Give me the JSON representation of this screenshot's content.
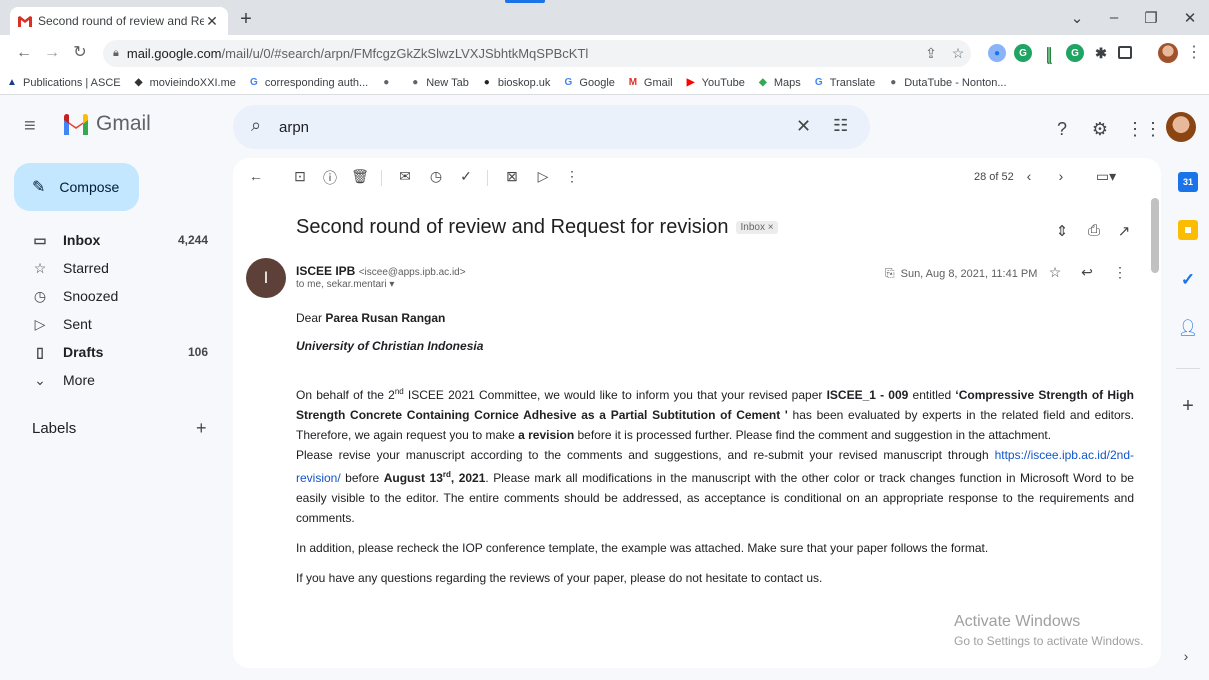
{
  "browser": {
    "tab_title": "Second round of review and Req",
    "tab_close": "✕",
    "new_tab": "+",
    "url_host": "mail.google.com",
    "url_path": "/mail/u/0/#search/arpn/FMfcgzGkZkSlwzLVXJSbhtkMqSPBcKTl"
  },
  "bookmarks": [
    {
      "label": "Publications | ASCE",
      "icon": "asce-icon",
      "glyph": "▲",
      "color": "#1a3c8c"
    },
    {
      "label": "movieindoXXI.me",
      "icon": "bird-icon",
      "glyph": "◆",
      "color": "#333"
    },
    {
      "label": "corresponding auth...",
      "icon": "google-icon",
      "glyph": "G",
      "color": "#4285f4"
    },
    {
      "label": "",
      "icon": "globe-icon",
      "glyph": "●",
      "color": "#5f6368"
    },
    {
      "label": "New Tab",
      "icon": "globe-icon",
      "glyph": "●",
      "color": "#5f6368"
    },
    {
      "label": "bioskop.uk",
      "icon": "bioskop-icon",
      "glyph": "●",
      "color": "#222"
    },
    {
      "label": "Google",
      "icon": "google-icon",
      "glyph": "G",
      "color": "#4285f4"
    },
    {
      "label": "Gmail",
      "icon": "gmail-icon",
      "glyph": "M",
      "color": "#d93025"
    },
    {
      "label": "YouTube",
      "icon": "youtube-icon",
      "glyph": "▶",
      "color": "#ff0000"
    },
    {
      "label": "Maps",
      "icon": "maps-icon",
      "glyph": "◆",
      "color": "#34a853"
    },
    {
      "label": "Translate",
      "icon": "translate-icon",
      "glyph": "G",
      "color": "#4285f4"
    },
    {
      "label": "DutaTube - Nonton...",
      "icon": "globe-icon",
      "glyph": "●",
      "color": "#5f6368"
    }
  ],
  "gmail": {
    "brand": "Gmail",
    "search_value": "arpn",
    "compose": "Compose",
    "nav": [
      {
        "label": "Inbox",
        "count": "4,244",
        "icon": "inbox-icon",
        "glyph": "▭",
        "bold": true
      },
      {
        "label": "Starred",
        "count": "",
        "icon": "star-icon",
        "glyph": "☆",
        "bold": false
      },
      {
        "label": "Snoozed",
        "count": "",
        "icon": "clock-icon",
        "glyph": "◷",
        "bold": false
      },
      {
        "label": "Sent",
        "count": "",
        "icon": "send-icon",
        "glyph": "▷",
        "bold": false
      },
      {
        "label": "Drafts",
        "count": "106",
        "icon": "draft-icon",
        "glyph": "▯",
        "bold": true
      },
      {
        "label": "More",
        "count": "",
        "icon": "chevron-down-icon",
        "glyph": "⌄",
        "bold": false
      }
    ],
    "labels_title": "Labels",
    "labels_add": "+"
  },
  "message": {
    "paging": "28 of 52",
    "subject": "Second round of review and Request for revision",
    "label_badge": "Inbox ×",
    "sender_initial": "I",
    "sender_name": "ISCEE IPB",
    "sender_email": "<iscee@apps.ipb.ac.id>",
    "to_line": "to me, sekar.mentari ▾",
    "date": "Sun, Aug 8, 2021, 11:41 PM",
    "greeting_prefix": "Dear ",
    "recipient_name": "Parea Rusan Rangan",
    "university": "University of Christian Indonesia",
    "p1_a": "On behalf of the 2",
    "p1_sup": "nd",
    "p1_b": " ISCEE 2021 Committee, we would like to inform you that your revised paper ",
    "p1_code": "ISCEE_1 - 009",
    "p1_c": " entitled ",
    "p1_title": "‘Compressive Strength of High Strength Concrete Containing Cornice Adhesive as a Partial Subtitution of Cement '",
    "p1_d": " has been evaluated by experts in the related field and editors. Therefore, we again request you to make ",
    "p1_rev": "a revision",
    "p1_e": " before it is processed further. Please find the comment and suggestion in the attachment.",
    "p2_a": "Please revise your manuscript according to the comments and suggestions, and re-submit your revised manuscript through ",
    "p2_link": "https://iscee.ipb.ac.id/2nd-revision/",
    "p2_b": " before ",
    "p2_date_a": "August 13",
    "p2_date_sup": "rd",
    "p2_date_b": ", 2021",
    "p2_c": ". Please mark all modifications in the manuscript with the other color or track changes function in Microsoft Word to be easily visible to the editor. The entire comments should be addressed, as acceptance is conditional on an appropriate response to the requirements and comments.",
    "p3": "In addition, please recheck the IOP conference template, the example was attached. Make sure that your paper follows the format.",
    "p4": "If you have any questions regarding the reviews of your paper, please do not hesitate to contact us."
  },
  "watermark": {
    "line1": "Activate Windows",
    "line2": "Go to Settings to activate Windows."
  },
  "colors": {
    "accent": "#1a73e8",
    "compose_bg": "#c2e7ff",
    "search_bg": "#eaf1fb",
    "sender_avatar": "#5d4037"
  }
}
